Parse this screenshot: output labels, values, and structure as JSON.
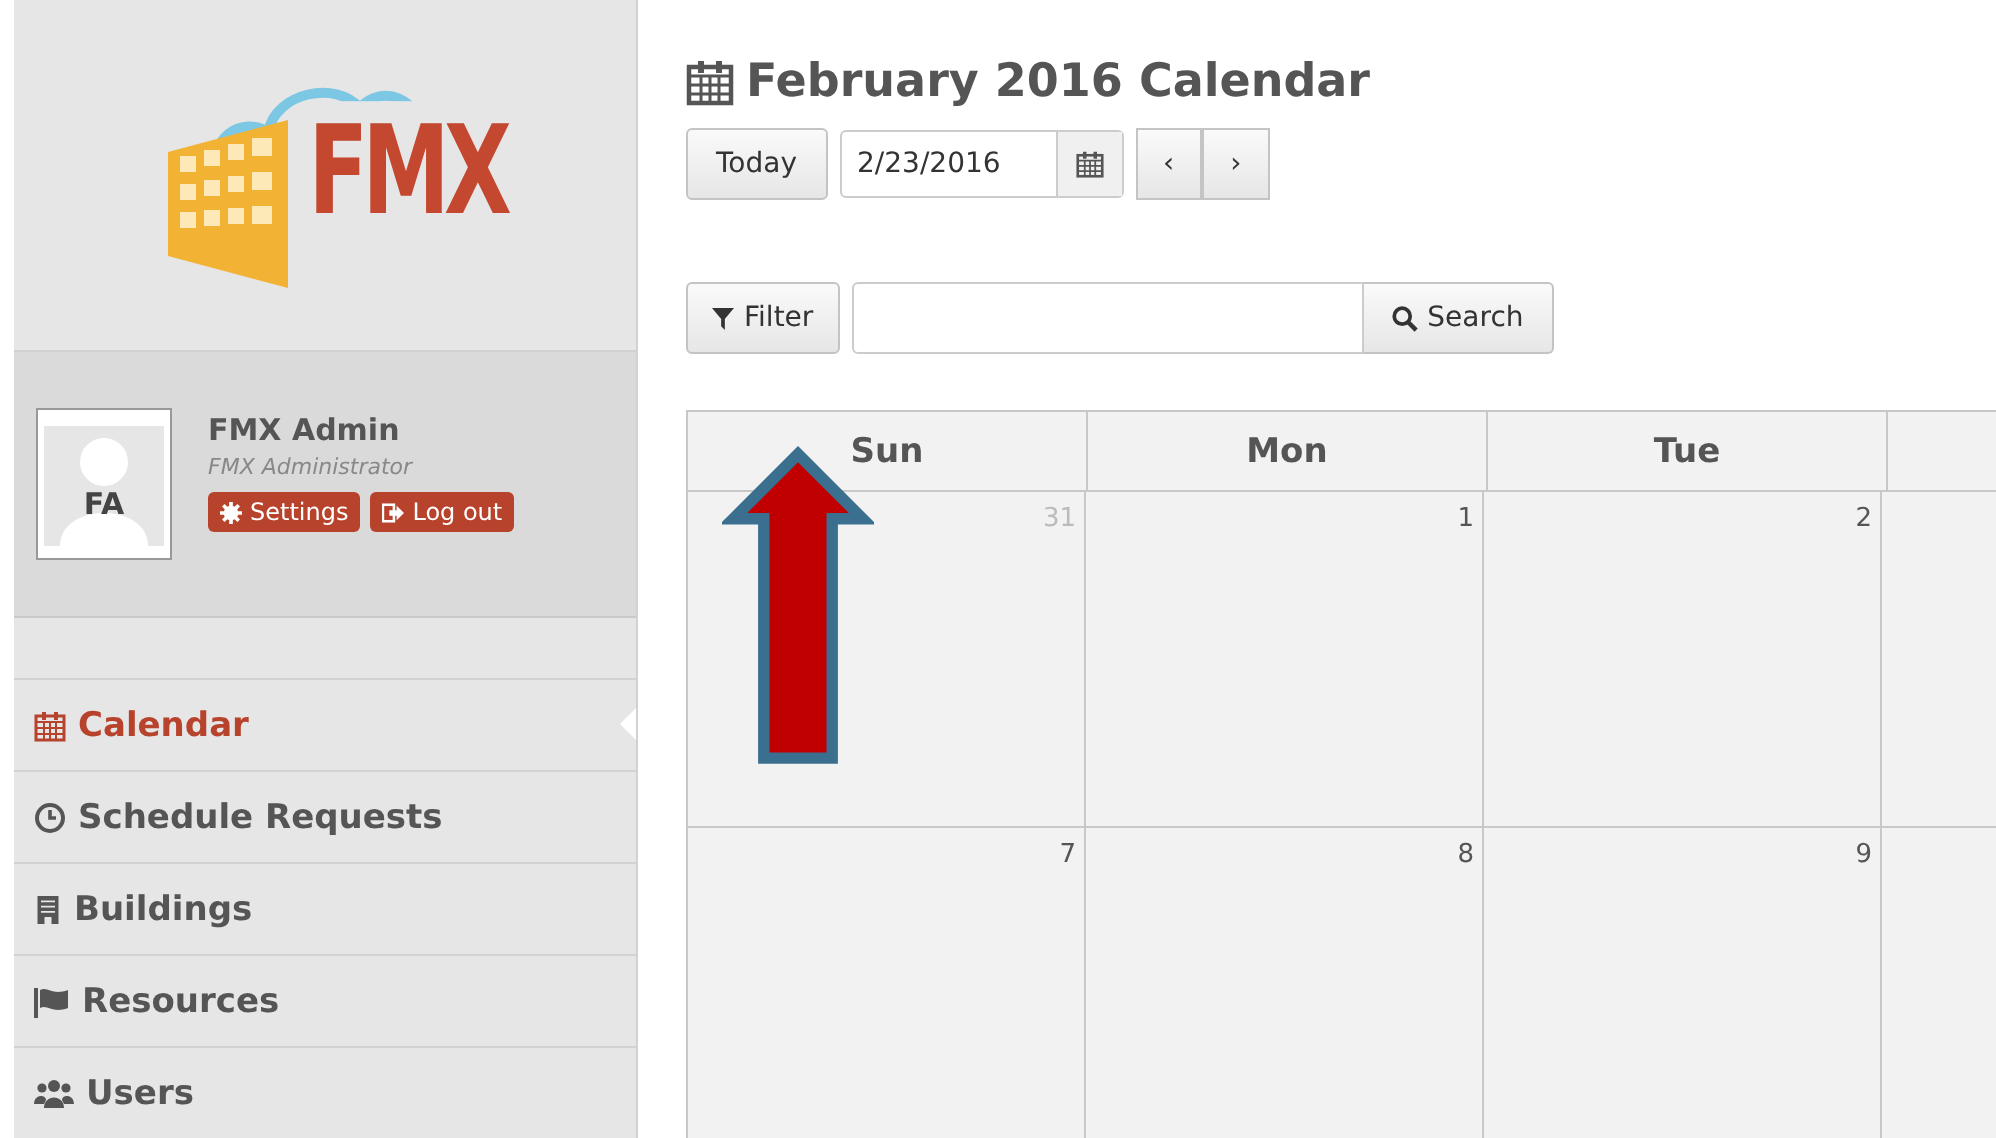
{
  "logo": {
    "text": "FMX"
  },
  "user": {
    "name": "FMX Admin",
    "role": "FMX Administrator",
    "initials": "FA",
    "buttons": [
      {
        "kind": "settings",
        "label": "Settings"
      },
      {
        "kind": "logout",
        "label": "Log out"
      }
    ]
  },
  "nav": [
    {
      "kind": "calendar",
      "label": "Calendar",
      "selected": true
    },
    {
      "kind": "clock",
      "label": "Schedule Requests",
      "selected": false
    },
    {
      "kind": "building",
      "label": "Buildings",
      "selected": false
    },
    {
      "kind": "flag",
      "label": "Resources",
      "selected": false
    },
    {
      "kind": "users",
      "label": "Users",
      "selected": false
    }
  ],
  "page": {
    "title": "February 2016 Calendar"
  },
  "toolbar": {
    "today": "Today",
    "date": "2/23/2016",
    "prev": "‹",
    "next": "›"
  },
  "filter": {
    "filter": "Filter",
    "search": "Search"
  },
  "calendar": {
    "columns": [
      "Sun",
      "Mon",
      "Tue"
    ],
    "weeks": [
      {
        "days": [
          {
            "label": "31",
            "other_month": true
          },
          {
            "label": "1",
            "other_month": false
          },
          {
            "label": "2",
            "other_month": false
          }
        ]
      },
      {
        "days": [
          {
            "label": "7",
            "other_month": false
          },
          {
            "label": "8",
            "other_month": false
          },
          {
            "label": "9",
            "other_month": false
          }
        ]
      }
    ]
  }
}
